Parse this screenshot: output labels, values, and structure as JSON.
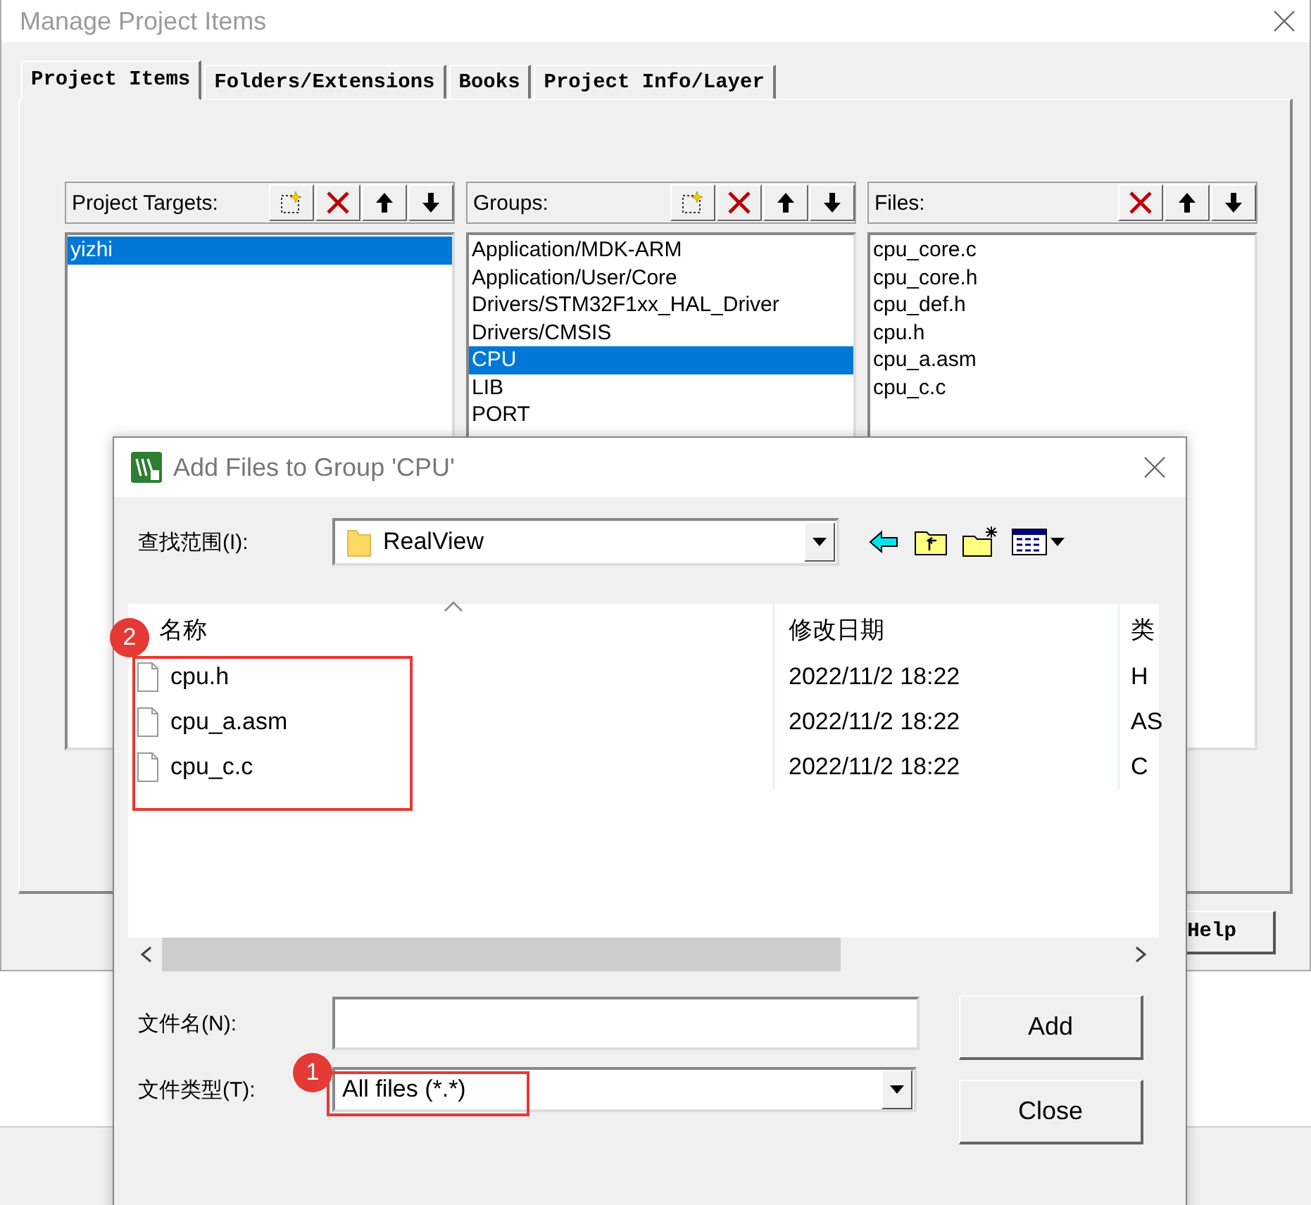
{
  "window": {
    "title": "Manage Project Items"
  },
  "tabs": [
    {
      "label": "Project Items",
      "selected": true
    },
    {
      "label": "Folders/Extensions",
      "selected": false
    },
    {
      "label": "Books",
      "selected": false
    },
    {
      "label": "Project Info/Layer",
      "selected": false
    }
  ],
  "panels": [
    {
      "title": "Project Targets:",
      "tools": [
        {
          "kind": "new"
        },
        {
          "kind": "delete"
        },
        {
          "kind": "up"
        },
        {
          "kind": "down"
        }
      ],
      "items": [
        {
          "label": "yizhi",
          "selected": true
        }
      ]
    },
    {
      "title": "Groups:",
      "tools": [
        {
          "kind": "new"
        },
        {
          "kind": "delete"
        },
        {
          "kind": "up"
        },
        {
          "kind": "down"
        }
      ],
      "items": [
        {
          "label": "Application/MDK-ARM",
          "selected": false
        },
        {
          "label": "Application/User/Core",
          "selected": false
        },
        {
          "label": "Drivers/STM32F1xx_HAL_Driver",
          "selected": false
        },
        {
          "label": "Drivers/CMSIS",
          "selected": false
        },
        {
          "label": "CPU",
          "selected": true
        },
        {
          "label": "LIB",
          "selected": false
        },
        {
          "label": "PORT",
          "selected": false
        }
      ]
    },
    {
      "title": "Files:",
      "tools": [
        {
          "kind": "delete"
        },
        {
          "kind": "up"
        },
        {
          "kind": "down"
        }
      ],
      "items": [
        {
          "label": "cpu_core.c",
          "selected": false
        },
        {
          "label": "cpu_core.h",
          "selected": false
        },
        {
          "label": "cpu_def.h",
          "selected": false
        },
        {
          "label": "cpu.h",
          "selected": false
        },
        {
          "label": "cpu_a.asm",
          "selected": false
        },
        {
          "label": "cpu_c.c",
          "selected": false
        }
      ]
    }
  ],
  "buttons": [
    "Help"
  ],
  "dialog": {
    "title": "Add Files to Group 'CPU'",
    "look_in_label": "查找范围(I):",
    "look_in": "RealView",
    "columns": [
      "名称",
      "修改日期",
      "类"
    ],
    "files": [
      {
        "name": "cpu.h",
        "modified": "2022/11/2 18:22",
        "type": "H"
      },
      {
        "name": "cpu_a.asm",
        "modified": "2022/11/2 18:22",
        "type": "AS"
      },
      {
        "name": "cpu_c.c",
        "modified": "2022/11/2 18:22",
        "type": "C"
      }
    ],
    "file_name_label": "文件名(N):",
    "file_type_label": "文件类型(T):",
    "file_type": "All files (*.*)",
    "buttons": [
      "Add",
      "Close"
    ],
    "files_annotation": {
      "badge": "2"
    },
    "file_type_annotation": {
      "badge": "1"
    }
  }
}
